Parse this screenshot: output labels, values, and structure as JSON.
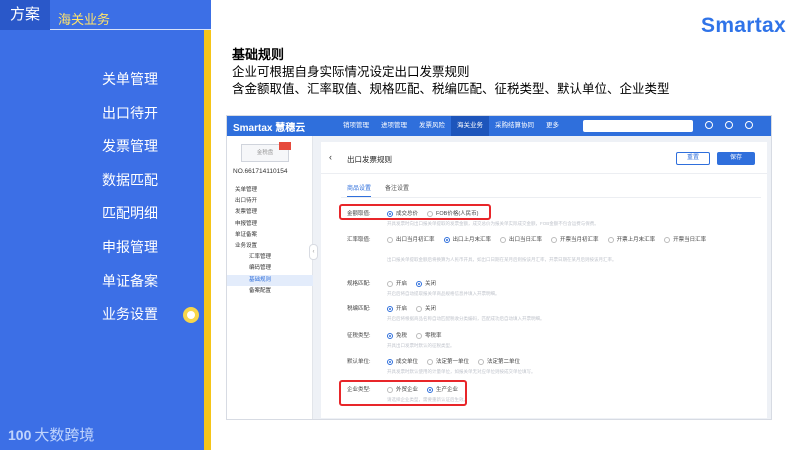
{
  "header": {
    "tab_label": "方案",
    "section_title": "海关业务"
  },
  "left_menu": [
    {
      "label": "关单管理"
    },
    {
      "label": "出口待开"
    },
    {
      "label": "发票管理"
    },
    {
      "label": "数据匹配"
    },
    {
      "label": "匹配明细"
    },
    {
      "label": "申报管理"
    },
    {
      "label": "单证备案"
    },
    {
      "label": "业务设置",
      "active": true
    }
  ],
  "left_footer": {
    "mark": "100",
    "name": "大数跨境"
  },
  "brand": {
    "name": "Smartax",
    "color": "#2f73e8"
  },
  "slide": {
    "heading": "基础规则",
    "line1": "企业可根据自身实际情况设定出口发票规则",
    "line2": "含金额取值、汇率取值、规格匹配、税编匹配、征税类型、默认单位、企业类型"
  },
  "app": {
    "logo": "Smartax 慧穗云",
    "nav": [
      "销项管理",
      "进项管理",
      "发票风险",
      "海关业务",
      "采购结算协同",
      "更多"
    ],
    "active_nav": "海关业务",
    "company_box": "金税盘",
    "company_no": "NO.661714110154",
    "side_menu": [
      {
        "label": "关单管理",
        "type": "main"
      },
      {
        "label": "出口待开",
        "type": "main"
      },
      {
        "label": "发票管理",
        "type": "main"
      },
      {
        "label": "申报管理",
        "type": "main"
      },
      {
        "label": "单证备案",
        "type": "main"
      },
      {
        "label": "业务设置",
        "type": "main"
      },
      {
        "label": "汇率管理",
        "type": "sub"
      },
      {
        "label": "编码管理",
        "type": "sub"
      },
      {
        "label": "基础规则",
        "type": "sub",
        "active": true
      },
      {
        "label": "备案配置",
        "type": "sub"
      }
    ],
    "page_title": "出口发票规则",
    "buttons": {
      "reset": "重置",
      "save": "保存"
    },
    "tabs": [
      "商品设置",
      "备注设置"
    ],
    "active_tab": "商品设置",
    "rules": [
      {
        "label": "金额取值:",
        "options": [
          "成交总价",
          "FOB价格(人民币)"
        ],
        "selected": 0,
        "hint": "开具发票时向出口报关单提取的发票金额，成交总价为报关单实际成交金额，FOB金额不包含运费与保费。"
      },
      {
        "label": "汇率取值:",
        "options": [
          "出口当月初汇率",
          "出口上月末汇率",
          "出口当日汇率",
          "开票当月初汇率",
          "开票上月末汇率",
          "开票当日汇率"
        ],
        "selected": 1,
        "hint": "出口报关单提取金额后将换算为人民币开具，如出口日期在某月后则按该月汇率，开票日期在某月后则按该月汇率。"
      },
      {
        "label": "规格匹配:",
        "options": [
          "开启",
          "关闭"
        ],
        "selected": 1,
        "hint": "开启后将自动提取报关单商品规格信息并填入开票明细。"
      },
      {
        "label": "税编匹配:",
        "options": [
          "开启",
          "关闭"
        ],
        "selected": 0,
        "hint": "开启后将根据商品名称自动匹配税收分类编码，匹配成功后自动填入开票明细。"
      },
      {
        "label": "征税类型:",
        "options": [
          "免税",
          "零税率"
        ],
        "selected": 0,
        "hint": "开具出口发票时默认的征税类型。"
      },
      {
        "label": "默认单位:",
        "options": [
          "成交单位",
          "法定第一单位",
          "法定第二单位"
        ],
        "selected": 0,
        "hint": "开具发票时默认使用的计量单位，如报关单无对应单位则按成交单位填写。"
      },
      {
        "label": "企业类型:",
        "options": [
          "外贸企业",
          "生产企业"
        ],
        "selected": 1,
        "hint": "请选择企业类型，需要重新认证后生效。"
      }
    ]
  }
}
